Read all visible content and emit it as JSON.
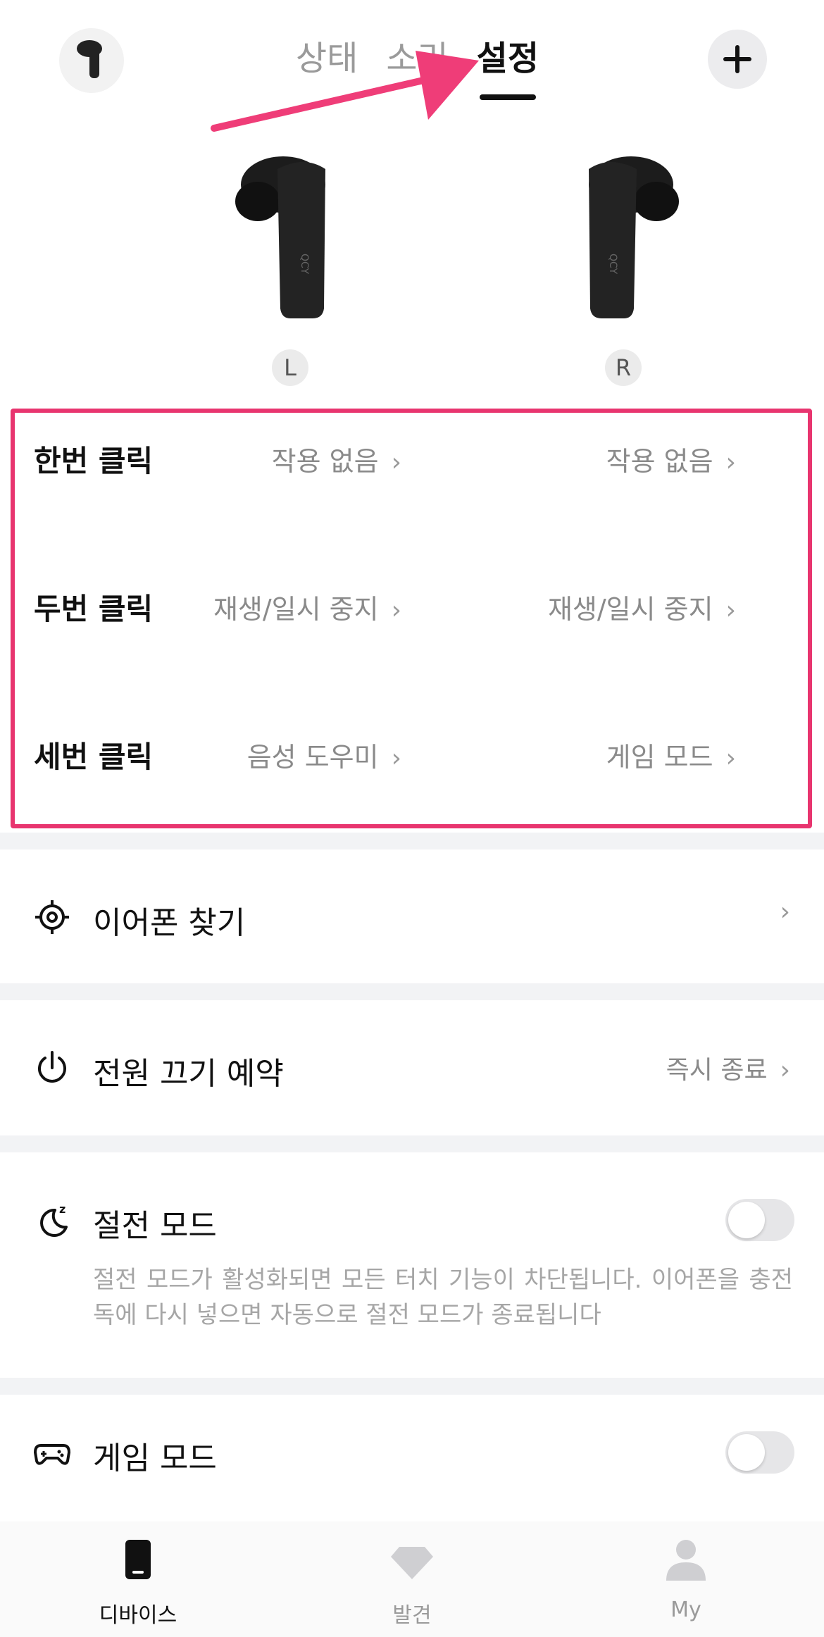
{
  "header": {
    "tabs": [
      {
        "label": "상태"
      },
      {
        "label": "소리"
      },
      {
        "label": "설정"
      }
    ],
    "active_tab": "설정"
  },
  "earbuds": {
    "left_label": "L",
    "right_label": "R"
  },
  "click_settings": [
    {
      "label": "한번 클릭",
      "left_value": "작용 없음",
      "right_value": "작용 없음"
    },
    {
      "label": "두번 클릭",
      "left_value": "재생/일시 중지",
      "right_value": "재생/일시 중지"
    },
    {
      "label": "세번 클릭",
      "left_value": "음성 도우미",
      "right_value": "게임 모드"
    }
  ],
  "settings": {
    "find_earphones": {
      "title": "이어폰 찾기",
      "icon": "target-icon"
    },
    "power_off_schedule": {
      "title": "전원 끄기 예약",
      "value": "즉시 종료",
      "icon": "power-icon"
    },
    "power_saving": {
      "title": "절전 모드",
      "icon": "moon-sleep-icon",
      "enabled": false,
      "description": "절전 모드가 활성화되면 모든 터치 기능이 차단됩니다. 이어폰을 충전독에 다시 넣으면 자동으로 절전 모드가 종료됩니다"
    },
    "game_mode": {
      "title": "게임 모드",
      "icon": "gamepad-icon",
      "enabled": false
    }
  },
  "bottom_nav": [
    {
      "label": "디바이스",
      "icon": "device-icon",
      "active": true
    },
    {
      "label": "발견",
      "icon": "diamond-icon",
      "active": false
    },
    {
      "label": "My",
      "icon": "user-icon",
      "active": false
    }
  ],
  "colors": {
    "accent_highlight": "#e8356f",
    "text_primary": "#111111",
    "text_secondary": "#8a8a8a",
    "section_divider": "#f2f3f5"
  }
}
